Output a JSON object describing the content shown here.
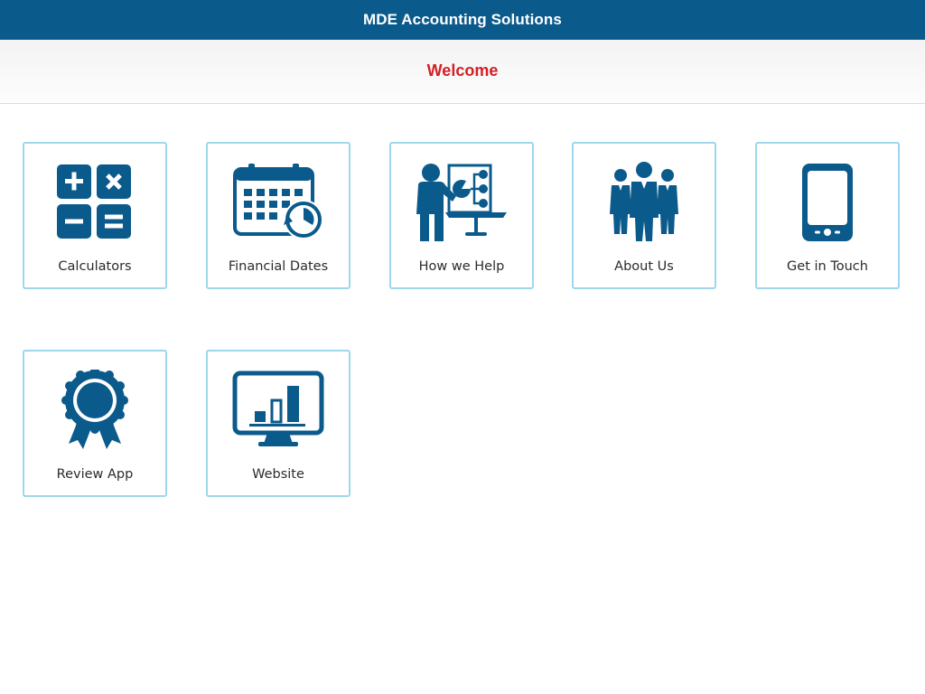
{
  "header": {
    "title": "MDE Accounting Solutions"
  },
  "subheader": {
    "welcome": "Welcome"
  },
  "colors": {
    "header_bg": "#0b5a8c",
    "icon": "#0b5a8c",
    "welcome_text": "#d41e26",
    "tile_border": "#9ed6ec"
  },
  "tiles": [
    {
      "label": "Calculators",
      "icon": "calculator-icon"
    },
    {
      "label": "Financial Dates",
      "icon": "calendar-clock-icon"
    },
    {
      "label": "How we Help",
      "icon": "presentation-icon"
    },
    {
      "label": "About Us",
      "icon": "team-icon"
    },
    {
      "label": "Get in Touch",
      "icon": "phone-icon"
    },
    {
      "label": "Review App",
      "icon": "award-ribbon-icon"
    },
    {
      "label": "Website",
      "icon": "monitor-chart-icon"
    }
  ]
}
